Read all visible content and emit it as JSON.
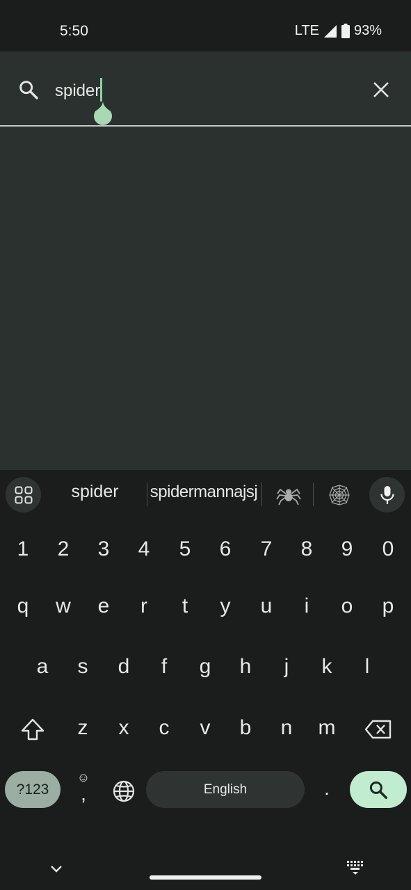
{
  "status_bar": {
    "time": "5:50",
    "network": "LTE",
    "battery": "93%"
  },
  "search": {
    "query": "spider",
    "icon": "search-icon",
    "clear_icon": "close-icon"
  },
  "keyboard": {
    "suggestions": [
      "spider",
      "spidermannajsj"
    ],
    "emoji_suggestions": [
      "spider-emoji",
      "spider-web-emoji"
    ],
    "number_row": [
      "1",
      "2",
      "3",
      "4",
      "5",
      "6",
      "7",
      "8",
      "9",
      "0"
    ],
    "row1": [
      "q",
      "w",
      "e",
      "r",
      "t",
      "y",
      "u",
      "i",
      "o",
      "p"
    ],
    "row2": [
      "a",
      "s",
      "d",
      "f",
      "g",
      "h",
      "j",
      "k",
      "l"
    ],
    "row3": [
      "z",
      "x",
      "c",
      "v",
      "b",
      "n",
      "m"
    ],
    "symbols_label": "?123",
    "comma": ",",
    "comma_emoji": "☺",
    "space_label": "English",
    "period": ".",
    "accent_color": "#c2ecd0"
  }
}
